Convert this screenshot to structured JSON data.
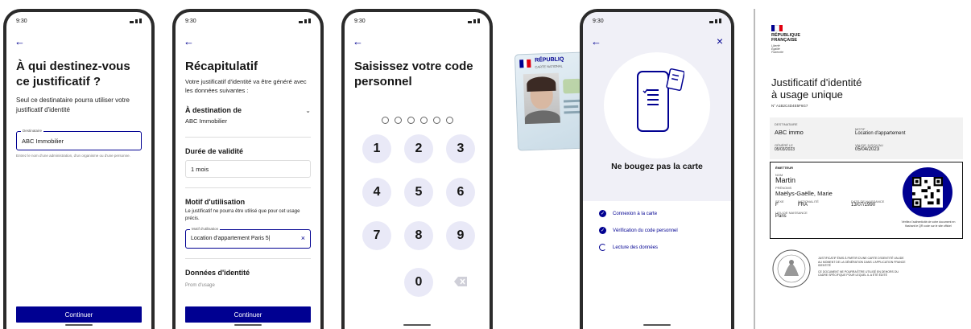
{
  "screens": {
    "one": {
      "time": "9:30",
      "title": "À qui destinez-vous ce justificatif ?",
      "desc": "Seul ce destinataire pourra utiliser votre justificatif d'identité",
      "field_label": "Destinataire",
      "field_value": "ABC Immobilier",
      "field_hint": "Entrez le nom d'une administration, d'un organisme ou d'une personne.",
      "button": "Continuer"
    },
    "two": {
      "time": "9:30",
      "title": "Récapitulatif",
      "desc": "Votre justificatif d'identité va être généré avec les données suivantes :",
      "dest_label": "À destination de",
      "dest_value": "ABC Immobilier",
      "validity_label": "Durée de validité",
      "validity_value": "1 mois",
      "motif_label": "Motif d'utilisation",
      "motif_desc": "Le justificatif ne pourra être utilisé que pour cet usage précis.",
      "motif_field_label": "Motif d'utilisation",
      "motif_field_value": "Location d'appartement Paris 5|",
      "identity_label": "Données d'identité",
      "identity_sub": "Prom d'usage",
      "button": "Continuer"
    },
    "three": {
      "time": "9:30",
      "title": "Saisissez votre code personnel",
      "keys": [
        "1",
        "2",
        "3",
        "4",
        "5",
        "6",
        "7",
        "8",
        "9",
        "0"
      ]
    },
    "card": {
      "header": "RÉPUBLIQ",
      "subheader": "CARTE NATIONAL"
    },
    "four": {
      "time": "9:30",
      "title": "Ne bougez pas la carte",
      "steps": [
        "Connexion à la carte",
        "Vérification du code personnel",
        "Lecture des données"
      ]
    }
  },
  "document": {
    "rf1": "RÉPUBLIQUE",
    "rf2": "FRANÇAISE",
    "devise1": "Liberté",
    "devise2": "Égalité",
    "devise3": "Fraternité",
    "title1": "Justificatif d'identité",
    "title2": "à usage unique",
    "number": "N° A1B2C4D4E5F6G7",
    "dest_label": "DESTINATAIRE",
    "dest_value": "ABC immo",
    "motif_label": "MOTIF",
    "motif_value": "Location d'appartement",
    "gen_label": "GÉNÉRÉ LE",
    "gen_value": "05/03/2023",
    "valid_label": "VALIDE JUSQU'AU",
    "valid_value": "05/04/2023",
    "emit_label": "ÉMETTEUR",
    "nom_label": "NOM",
    "nom_value": "Martin",
    "prenoms_label": "PRÉNOMS",
    "prenoms_value": "Maëlys-Gaëlle, Marie",
    "sexe_label": "SEXE",
    "sexe_value": "F",
    "nat_label": "NATIONALITÉ",
    "nat_value": "FRA",
    "birth_label": "DATE DE NAISSANCE",
    "birth_value": "13/07/1990",
    "place_label": "LIEU DE NAISSANCE",
    "place_value": "Paris",
    "qr_caption": "Vérifiez l'authenticité de votre document en flashant le QR code sur le site officiel",
    "stamp_note1": "JUSTIFICATIF ÉMIS À PARTIR D'UNE CARTE D'IDENTITÉ VALIDE AU MOMENT DE LA GÉNÉRATION DANS L'APPLICATION FRANCE IDENTITÉ",
    "stamp_note2": "CE DOCUMENT NE POURRA ÊTRE UTILISÉ EN DEHORS DU CADRE SPÉCIFIQUE POUR LEQUEL IL A ÉTÉ ÉDITÉ"
  },
  "colors": {
    "primary": "#000091",
    "red": "#e1000f",
    "keypad": "#e9e9f7"
  }
}
